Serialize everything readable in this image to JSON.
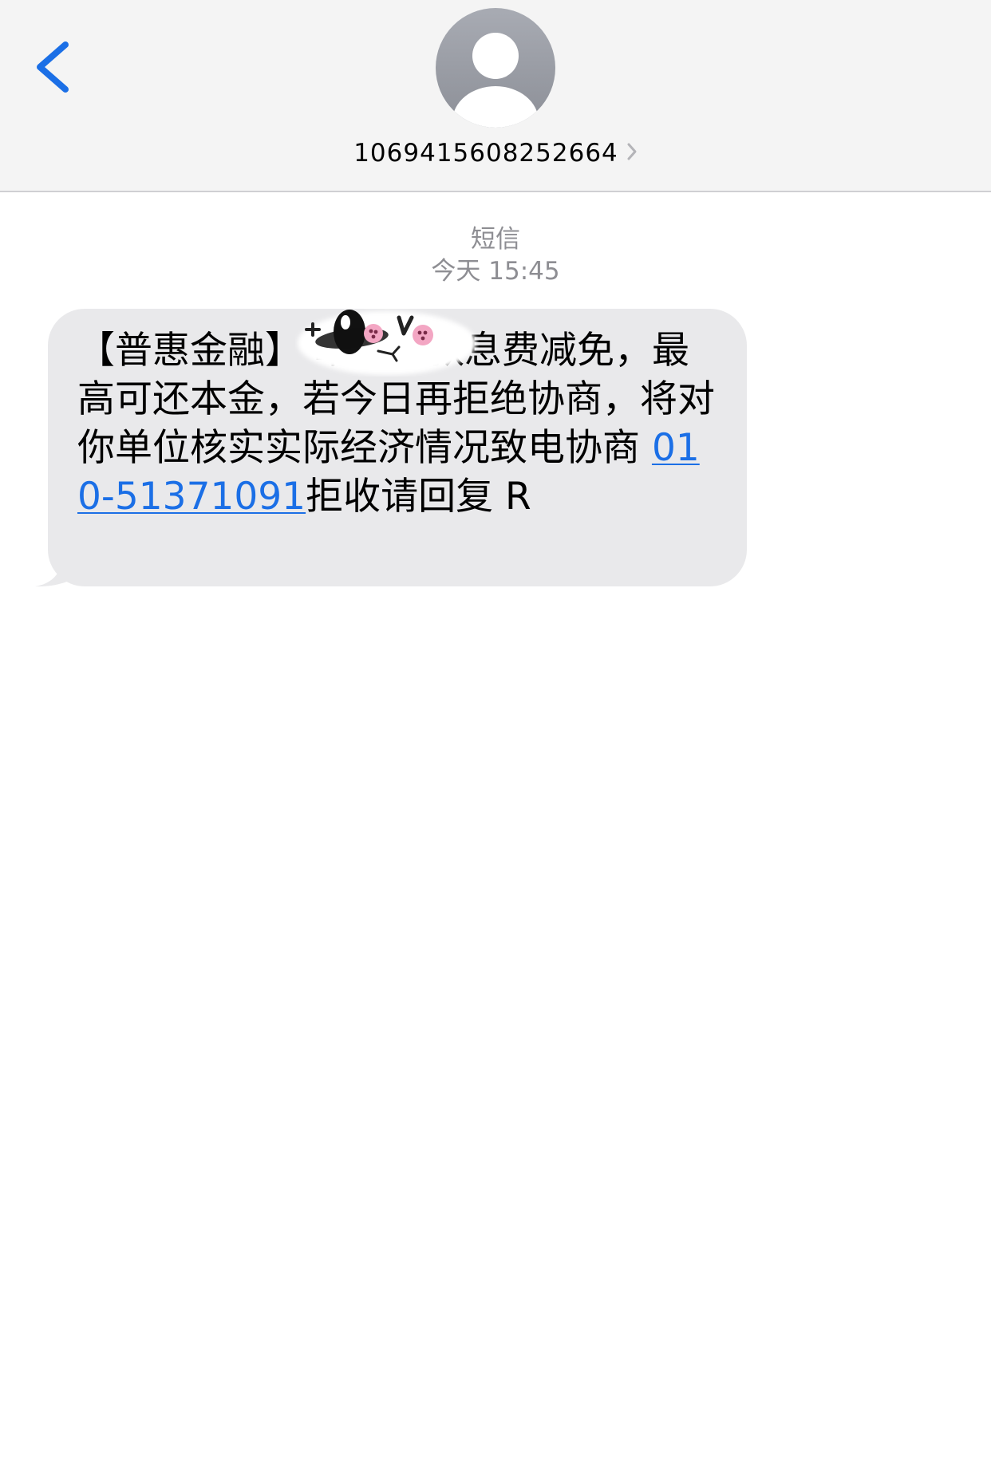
{
  "header": {
    "contact_number": "1069415608252664"
  },
  "conversation": {
    "service_label": "短信",
    "timestamp": "今天 15:45"
  },
  "message": {
    "text_before_link": "【普惠金融】 卓越欠款息费减免，最高可还本金，若今日再拒绝协商，将对你单位核实实际经济情况致电协商 ",
    "phone_link": "010-51371091",
    "text_after_link": "拒收请回复 R"
  },
  "colors": {
    "accent": "#1b6fe6",
    "bubble_bg": "#e9e9eb",
    "header_bg": "#f4f4f4",
    "meta_gray": "#8e8e93"
  },
  "icons": {
    "back": "chevron-left-icon",
    "avatar": "person-icon",
    "disclosure": "chevron-right-icon",
    "sticker": "redaction-sticker"
  }
}
